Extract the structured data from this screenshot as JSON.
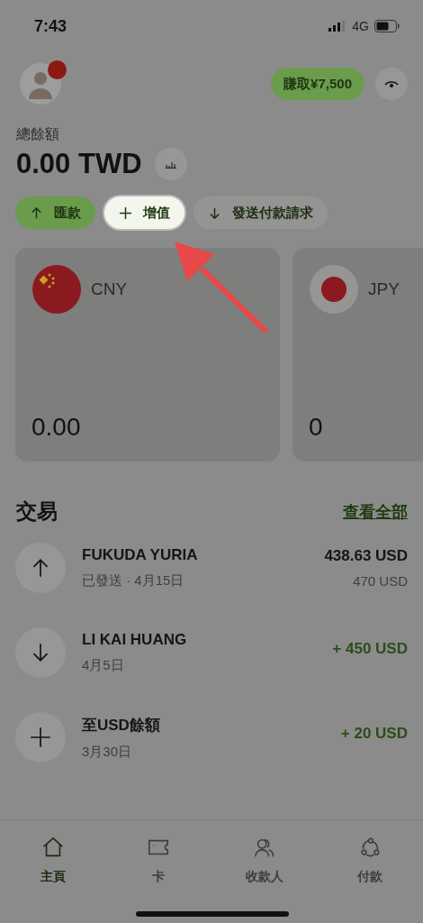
{
  "status_bar": {
    "time": "7:43",
    "network": "4G"
  },
  "header": {
    "avatar_badge": true,
    "earn_button": "賺取¥7,500"
  },
  "balance": {
    "label": "總餘額",
    "amount": "0.00 TWD"
  },
  "actions": [
    {
      "label": "匯款",
      "kind": "up",
      "primary": true,
      "highlighted": false
    },
    {
      "label": "增值",
      "kind": "plus",
      "primary": false,
      "highlighted": true
    },
    {
      "label": "發送付款請求",
      "kind": "down",
      "primary": false,
      "highlighted": false
    }
  ],
  "accounts": [
    {
      "currency": "CNY",
      "balance": "0.00",
      "kind": "cn"
    },
    {
      "currency": "JPY",
      "balance": "0",
      "kind": "jp"
    }
  ],
  "transactions": {
    "title": "交易",
    "view_all": "查看全部",
    "items": [
      {
        "name": "FUKUDA YURIA",
        "detail": "已發送 · 4月15日",
        "amount": "438.63 USD",
        "sub_amount": "470 USD",
        "kind": "out"
      },
      {
        "name": "LI KAI HUANG",
        "detail": "4月5日",
        "amount": "+ 450 USD",
        "kind": "in"
      },
      {
        "name": "至USD餘額",
        "detail": "3月30日",
        "amount": "+ 20 USD",
        "kind": "add"
      }
    ]
  },
  "nav": [
    {
      "label": "主頁",
      "kind": "home",
      "selected": true
    },
    {
      "label": "卡",
      "kind": "card",
      "selected": false
    },
    {
      "label": "收款人",
      "kind": "people",
      "selected": false
    },
    {
      "label": "付款",
      "kind": "pay",
      "selected": false
    }
  ]
}
